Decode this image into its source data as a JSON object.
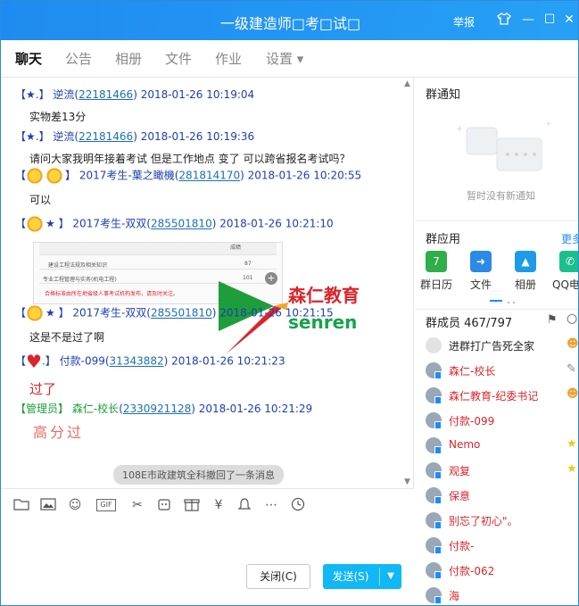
{
  "window": {
    "title": "一级建造师□考□试□",
    "report": "举报",
    "minimize": "—",
    "maximize": "☐",
    "close": "✕"
  },
  "tabs": [
    {
      "label": "聊天",
      "active": true
    },
    {
      "label": "公告"
    },
    {
      "label": "相册"
    },
    {
      "label": "文件"
    },
    {
      "label": "作业"
    },
    {
      "label": "设置 ▾"
    }
  ],
  "messages": [
    {
      "tag": "【★.】",
      "name": "逆流",
      "qq": "22181466",
      "time": "2018-01-26 10:19:04",
      "text": "实物差13分"
    },
    {
      "tag": "【★.】",
      "name": "逆流",
      "qq": "22181466",
      "time": "2018-01-26 10:19:36",
      "text": "请问大家我明年接着考试  但是工作地点 变了   可以跨省报名考试吗？"
    },
    {
      "tag_l": "【",
      "tag_r": "】",
      "name": "2017考生-葉之瞰機",
      "qq": "281814170",
      "time": "2018-01-26 10:20:55",
      "text": "可以"
    },
    {
      "tag_l": "【",
      "tag_r": "★ 】",
      "name": "2017考生-双双",
      "qq": "285501810",
      "time": "2018-01-26 10:21:10"
    },
    {
      "tag_l": "【",
      "tag_r": "★ 】",
      "name": "2017考生-双双",
      "qq": "285501810",
      "time": "2018-01-26 10:21:15",
      "text": "这是不是过了啊"
    },
    {
      "tag_l": "【",
      "tag_r": ".】",
      "name": "付款-099",
      "qq": "31343882",
      "time": "2018-01-26 10:21:23",
      "text": "过了"
    },
    {
      "tag": "【管理员】",
      "name": "森仁-校长",
      "qq": "2330921128",
      "time": "2018-01-26 10:21:29"
    }
  ],
  "image_card": {
    "rows": [
      {
        "label": "建设工程法规及相关知识",
        "value": "87"
      },
      {
        "label": "专业工程管理与实务(机电工程)",
        "value": "101"
      },
      {
        "label": "合格标准由所在地省级人事考试机构发布，请及时关注。",
        "value": ""
      }
    ],
    "header_right": "成绩"
  },
  "logo": {
    "cn": "森仁教育",
    "en": "senren"
  },
  "handwriting": "高分过",
  "recall_notice": "108E市政建筑全科撤回了一条消息",
  "toolbar": {
    "gif": "GIF"
  },
  "buttons": {
    "close": "关闭(C)",
    "send": "发送(S)"
  },
  "right_panel": {
    "notice_title": "群通知",
    "notice_empty": "暂时没有新通知",
    "apps_title": "群应用",
    "more": "更多",
    "apps": [
      {
        "label": "群日历",
        "icon": "calendar-icon",
        "color": "#2fae4a",
        "glyph": "7"
      },
      {
        "label": "文件",
        "icon": "file-icon",
        "color": "#2b8ae6",
        "glyph": "➜"
      },
      {
        "label": "相册",
        "icon": "album-icon",
        "color": "#1e9be8",
        "glyph": "▲"
      },
      {
        "label": "QQ电话",
        "icon": "phone-icon",
        "color": "#1bbf8e",
        "glyph": "✆"
      }
    ],
    "members_title": "群成员 467/797",
    "members": [
      {
        "name": "进群打广告死全家",
        "color": "#222",
        "side": "person"
      },
      {
        "name": "森仁-校长",
        "color": "#d8262c",
        "side": "edit"
      },
      {
        "name": "森仁教育-纪委书记",
        "color": "#d8262c",
        "side": "person"
      },
      {
        "name": "付款-099",
        "color": "#d8262c",
        "side": ""
      },
      {
        "name": "Nemo",
        "color": "#d8262c",
        "side": "star"
      },
      {
        "name": "观复",
        "color": "#d8262c",
        "side": "star"
      },
      {
        "name": "保意",
        "color": "#d8262c",
        "side": ""
      },
      {
        "name": "别忘了初心\"。",
        "color": "#d8262c",
        "side": ""
      },
      {
        "name": "付款-",
        "color": "#d8262c",
        "side": ""
      },
      {
        "name": "付款-062",
        "color": "#d8262c",
        "side": ""
      },
      {
        "name": "海",
        "color": "#d8262c",
        "side": ""
      }
    ]
  }
}
